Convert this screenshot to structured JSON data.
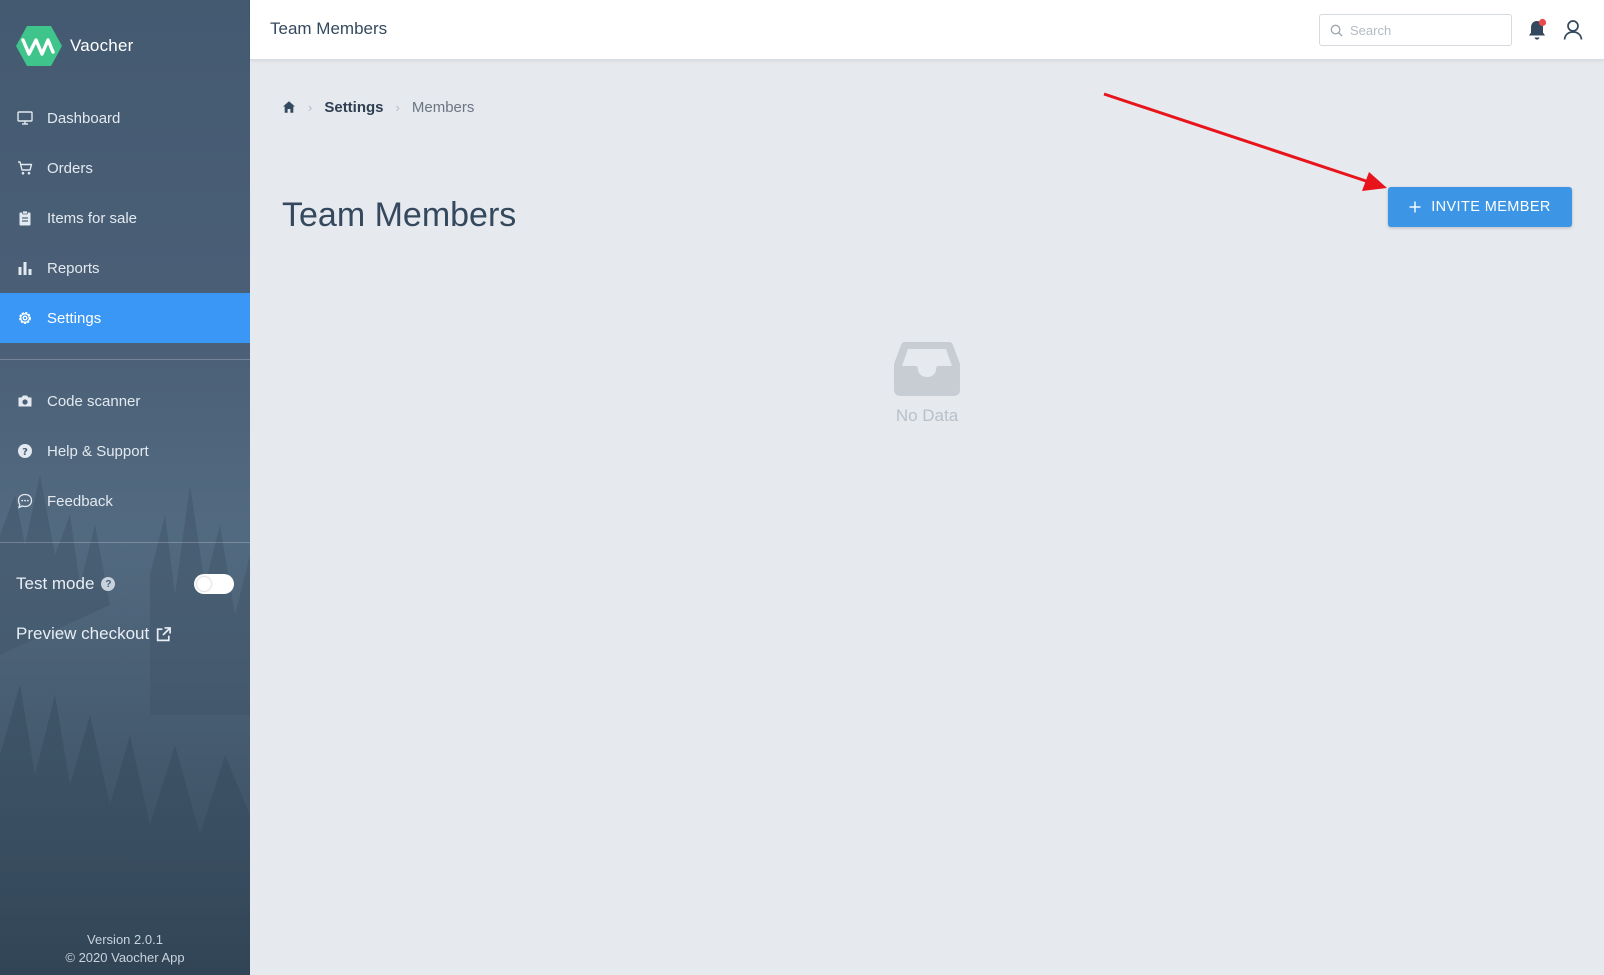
{
  "app": {
    "name": "Vaocher"
  },
  "sidebar": {
    "items": [
      {
        "label": "Dashboard",
        "icon": "monitor-icon"
      },
      {
        "label": "Orders",
        "icon": "cart-icon"
      },
      {
        "label": "Items for sale",
        "icon": "clipboard-icon"
      },
      {
        "label": "Reports",
        "icon": "bar-chart-icon"
      },
      {
        "label": "Settings",
        "icon": "gear-icon",
        "active": true
      }
    ],
    "secondary": [
      {
        "label": "Code scanner",
        "icon": "camera-icon"
      },
      {
        "label": "Help & Support",
        "icon": "question-icon"
      },
      {
        "label": "Feedback",
        "icon": "chat-icon"
      }
    ],
    "test_mode": {
      "label": "Test mode",
      "help": "?",
      "enabled": false
    },
    "preview_checkout": "Preview checkout",
    "version": "Version 2.0.1",
    "copyright": "© 2020 Vaocher App"
  },
  "header": {
    "title": "Team Members",
    "search_placeholder": "Search"
  },
  "breadcrumb": {
    "items": [
      "Settings",
      "Members"
    ]
  },
  "main": {
    "title": "Team Members",
    "invite_label": "INVITE MEMBER",
    "empty_text": "No Data"
  },
  "colors": {
    "accent": "#3a97f5",
    "button": "#3c96e5",
    "logo": "#3fc58b",
    "annotation_arrow": "#e8141b",
    "notification_dot": "#ea4a4a"
  }
}
